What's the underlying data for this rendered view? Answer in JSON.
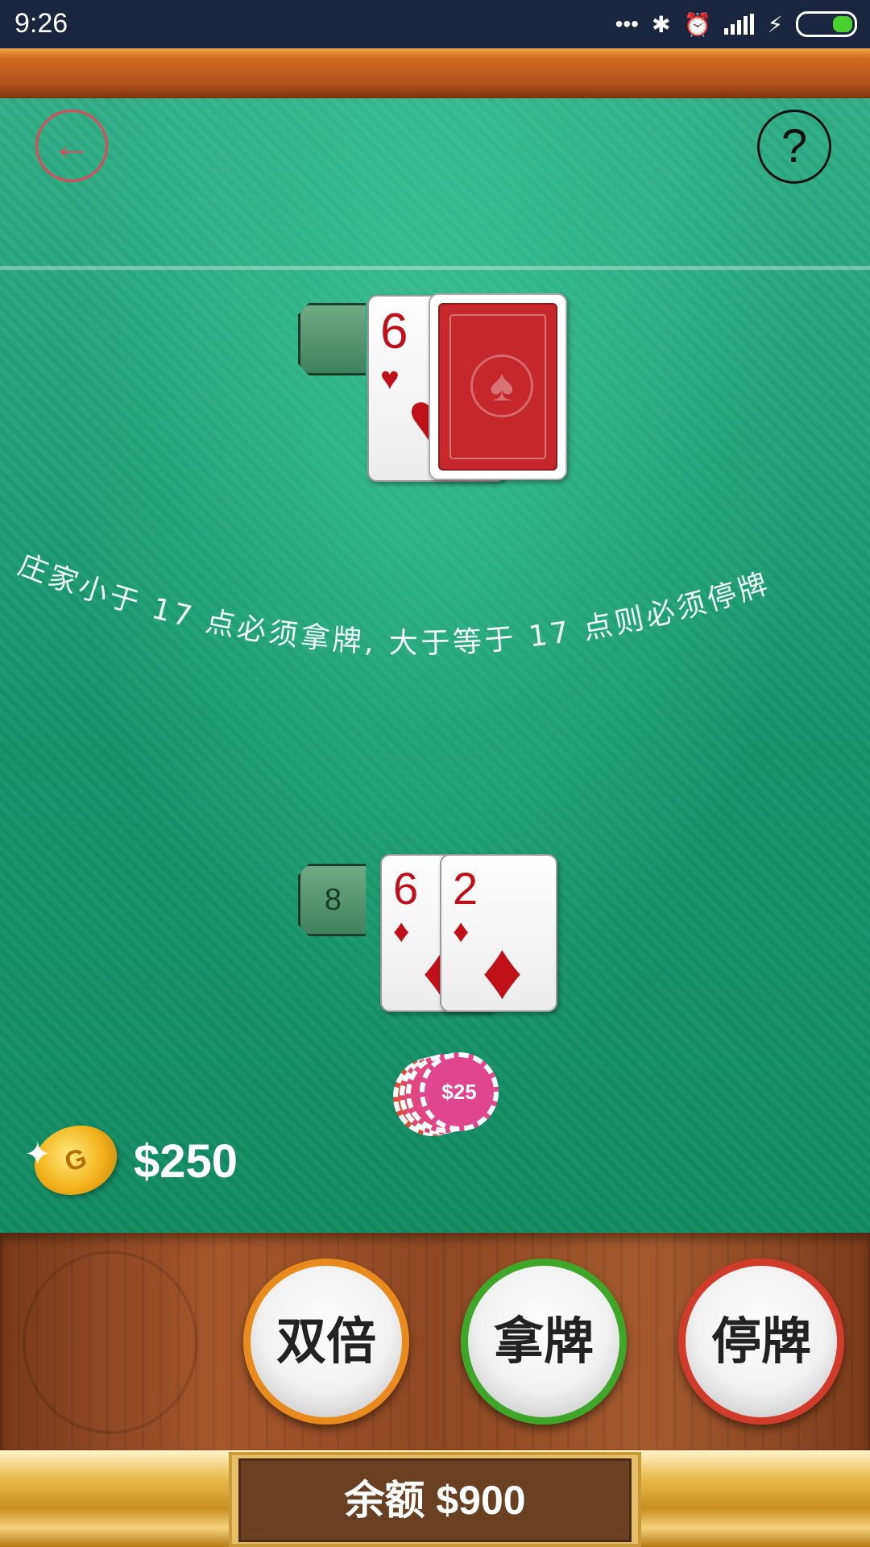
{
  "status_bar": {
    "time": "9:26",
    "icons": [
      "more-icon",
      "bluetooth-icon",
      "alarm-icon",
      "signal-icon",
      "charging-icon",
      "battery-icon"
    ],
    "battery_color": "#4ad02e"
  },
  "header": {
    "back_icon": "←",
    "help_icon": "?"
  },
  "dealer": {
    "score": "",
    "cards": [
      {
        "rank": "6",
        "suit": "♥",
        "face_up": true
      },
      {
        "rank": "",
        "suit": "",
        "face_up": false
      }
    ]
  },
  "rule_text": "庄家小于 17 点必须拿牌, 大于等于 17 点则必须停牌",
  "player": {
    "score": "8",
    "cards": [
      {
        "rank": "6",
        "suit": "♦",
        "face_up": true
      },
      {
        "rank": "2",
        "suit": "♦",
        "face_up": true
      }
    ]
  },
  "bet_chip": {
    "label": "$25",
    "color": "#e0458f"
  },
  "coin_total": "$250",
  "actions": {
    "double_label": "双倍",
    "hit_label": "拿牌",
    "stand_label": "停牌"
  },
  "balance": {
    "text": "余额 $900"
  },
  "colors": {
    "felt": "#1f9a73",
    "double_ring": "#e88a1e",
    "hit_ring": "#3ea628",
    "stand_ring": "#d03b2a",
    "card_red": "#c0101a"
  }
}
